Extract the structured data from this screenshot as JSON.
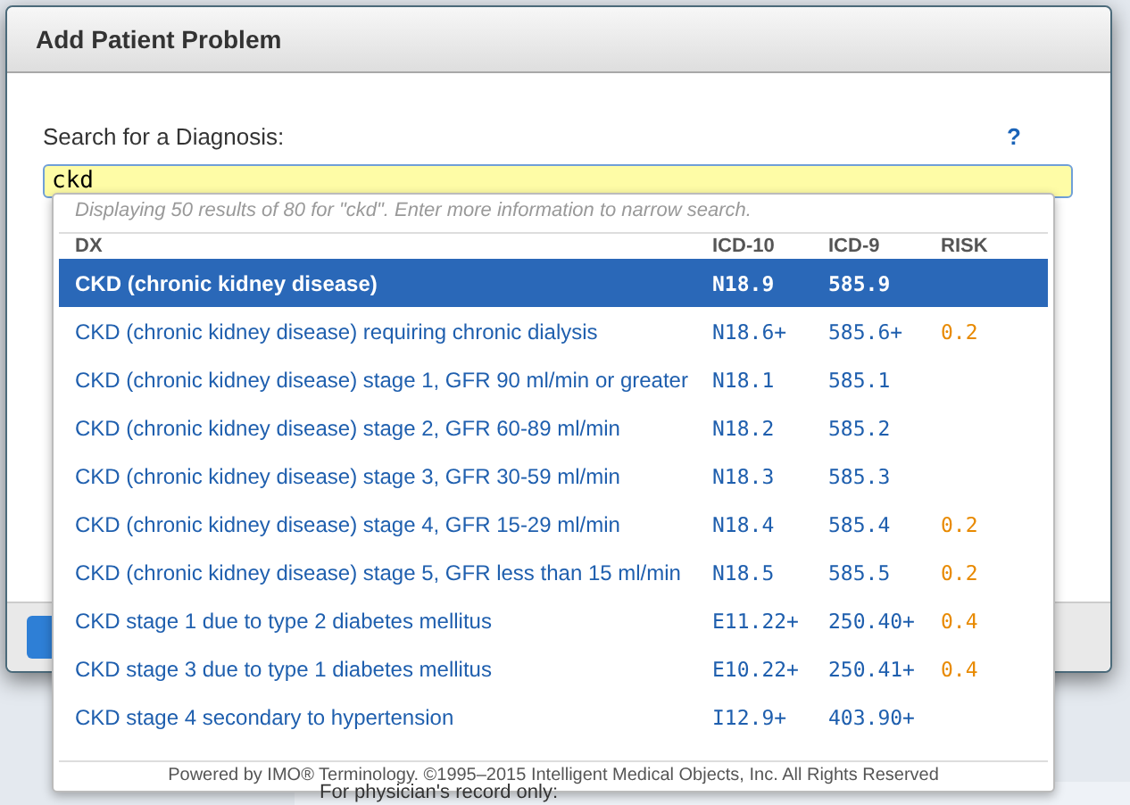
{
  "dialog": {
    "title": "Add Patient Problem",
    "search_label": "Search for a Diagnosis:",
    "help": "?",
    "search_value": "ckd"
  },
  "results": {
    "summary": "Displaying 50 results of 80 for \"ckd\". Enter more information to narrow search.",
    "columns": [
      "DX",
      "ICD-10",
      "ICD-9",
      "RISK"
    ],
    "rows": [
      {
        "dx": "CKD (chronic kidney disease)",
        "icd10": "N18.9",
        "icd9": "585.9",
        "risk": "",
        "selected": true
      },
      {
        "dx": "CKD (chronic kidney disease) requiring chronic dialysis",
        "icd10": "N18.6+",
        "icd9": "585.6+",
        "risk": "0.2",
        "selected": false
      },
      {
        "dx": "CKD (chronic kidney disease) stage 1, GFR 90 ml/min or greater",
        "icd10": "N18.1",
        "icd9": "585.1",
        "risk": "",
        "selected": false
      },
      {
        "dx": "CKD (chronic kidney disease) stage 2, GFR 60-89 ml/min",
        "icd10": "N18.2",
        "icd9": "585.2",
        "risk": "",
        "selected": false
      },
      {
        "dx": "CKD (chronic kidney disease) stage 3, GFR 30-59 ml/min",
        "icd10": "N18.3",
        "icd9": "585.3",
        "risk": "",
        "selected": false
      },
      {
        "dx": "CKD (chronic kidney disease) stage 4, GFR 15-29 ml/min",
        "icd10": "N18.4",
        "icd9": "585.4",
        "risk": "0.2",
        "selected": false
      },
      {
        "dx": "CKD (chronic kidney disease) stage 5, GFR less than 15 ml/min",
        "icd10": "N18.5",
        "icd9": "585.5",
        "risk": "0.2",
        "selected": false
      },
      {
        "dx": "CKD stage 1 due to type 2 diabetes mellitus",
        "icd10": "E11.22+",
        "icd9": "250.40+",
        "risk": "0.4",
        "selected": false
      },
      {
        "dx": "CKD stage 3 due to type 1 diabetes mellitus",
        "icd10": "E10.22+",
        "icd9": "250.41+",
        "risk": "0.4",
        "selected": false
      },
      {
        "dx": "CKD stage 4 secondary to hypertension",
        "icd10": "I12.9+",
        "icd9": "403.90+",
        "risk": "",
        "selected": false
      }
    ],
    "footer": "Powered by IMO® Terminology. ©1995–2015 Intelligent Medical Objects, Inc. All Rights Reserved"
  },
  "page": {
    "note": "For physician's record only:"
  }
}
